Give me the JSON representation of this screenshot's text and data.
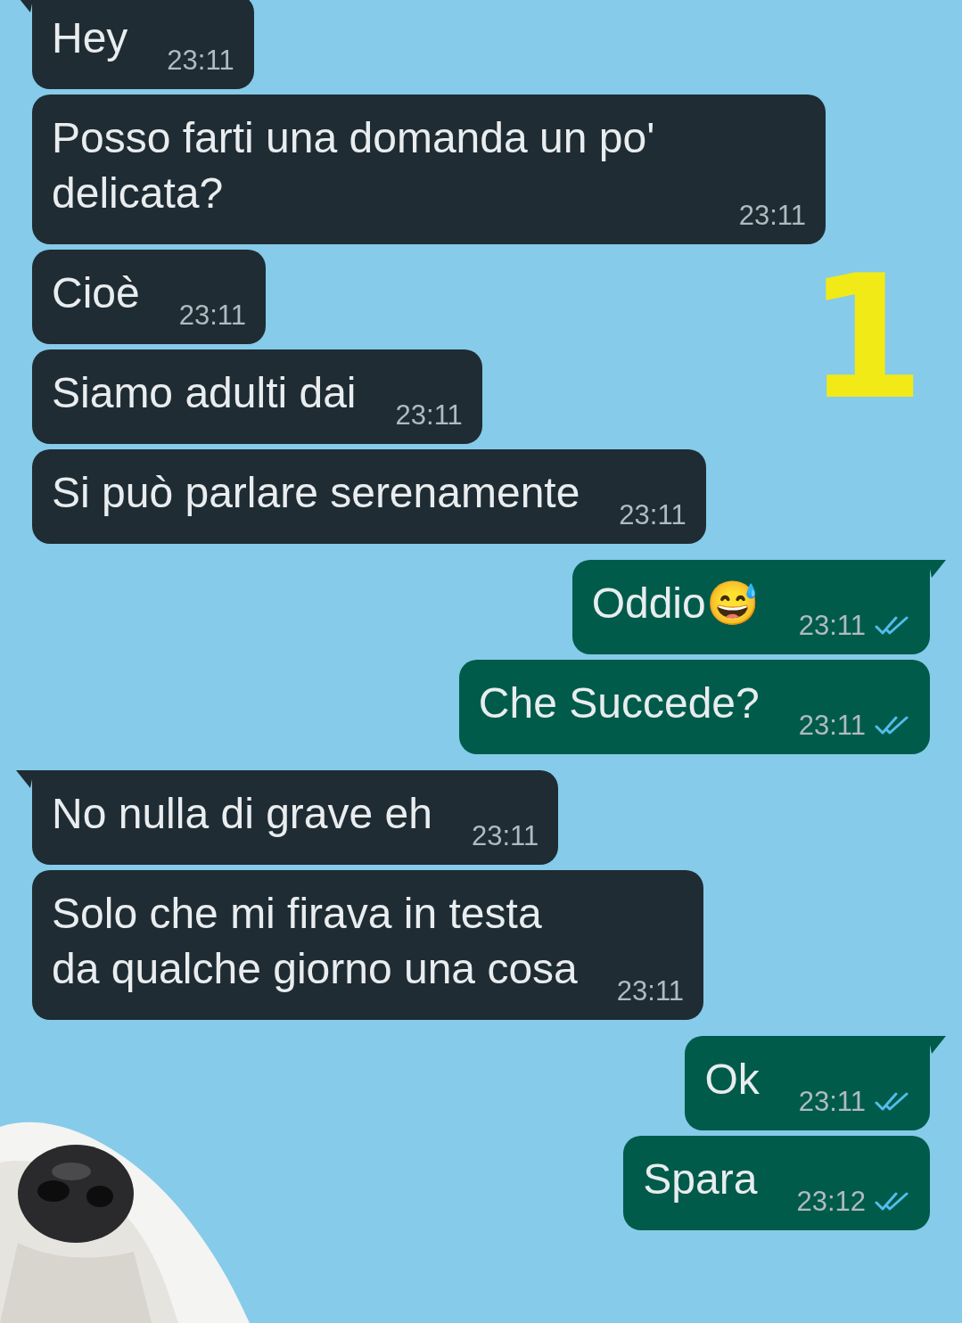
{
  "annotation": "1",
  "messages": [
    {
      "kind": "incoming",
      "tail": true,
      "text": "Hey",
      "time": "23:11"
    },
    {
      "kind": "incoming",
      "tail": false,
      "text": "Posso farti una domanda un po' delicata?",
      "time": "23:11"
    },
    {
      "kind": "incoming",
      "tail": false,
      "text": "Cioè",
      "time": "23:11"
    },
    {
      "kind": "incoming",
      "tail": false,
      "text": "Siamo adulti dai",
      "time": "23:11"
    },
    {
      "kind": "incoming",
      "tail": false,
      "text": "Si può parlare serenamente",
      "time": "23:11"
    },
    {
      "kind": "outgoing",
      "tail": true,
      "text": "Oddio😅",
      "time": "23:11",
      "read": true
    },
    {
      "kind": "outgoing",
      "tail": false,
      "text": "Che Succede?",
      "time": "23:11",
      "read": true
    },
    {
      "kind": "incoming",
      "tail": true,
      "text": "No nulla di grave eh",
      "time": "23:11"
    },
    {
      "kind": "incoming",
      "tail": false,
      "text": "Solo che mi firava in testa\nda qualche giorno una cosa",
      "time": "23:11"
    },
    {
      "kind": "outgoing",
      "tail": true,
      "text": "Ok",
      "time": "23:11",
      "read": true
    },
    {
      "kind": "outgoing",
      "tail": false,
      "text": "Spara",
      "time": "23:12",
      "read": true
    }
  ]
}
